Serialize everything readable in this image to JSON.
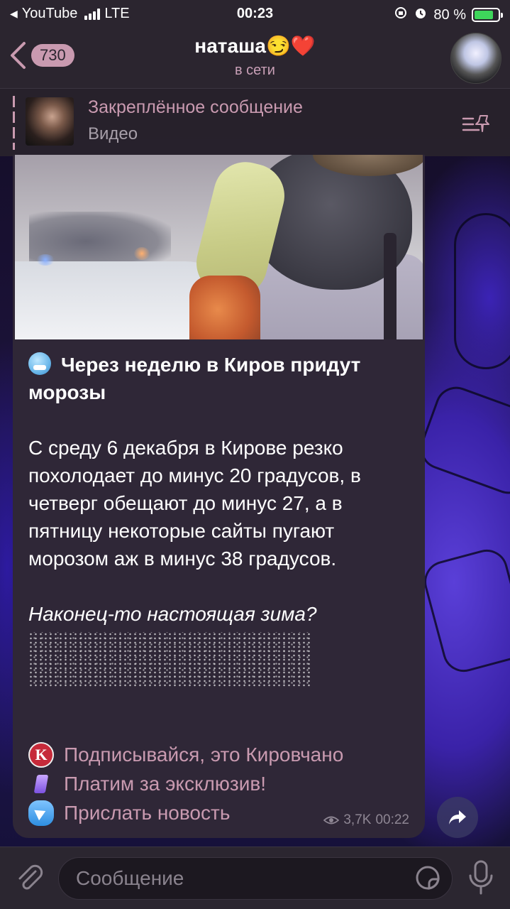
{
  "status_bar": {
    "back_app": "YouTube",
    "network": "LTE",
    "time": "00:23",
    "battery": "80 %",
    "battery_level": 0.8
  },
  "header": {
    "back_count": "730",
    "title": "наташа😏❤️",
    "subtitle": "в сети"
  },
  "pinned": {
    "title": "Закреплённое сообщение",
    "subtitle": "Видео"
  },
  "message": {
    "title": "Через неделю в Киров придут морозы",
    "body": "С среду 6 декабря в Кирове резко похолодает до минус 20 градусов, в четверг обещают до минус 27, а в пятницу некоторые сайты пугают морозом аж в минус 38 градусов.",
    "question": "Наконец-то настоящая зима?",
    "links": [
      {
        "label": "Подписывайся, это Кировчано",
        "icon": "kirov-logo-icon"
      },
      {
        "label": "Платим за эксклюзив!",
        "icon": "gem-icon"
      },
      {
        "label": "Прислать новость",
        "icon": "telegram-icon"
      }
    ],
    "views": "3,7K",
    "time": "00:22"
  },
  "input": {
    "placeholder": "Сообщение"
  },
  "colors": {
    "accent": "#c99ab0",
    "bubble": "#2f2737",
    "bar": "#2c2630"
  }
}
